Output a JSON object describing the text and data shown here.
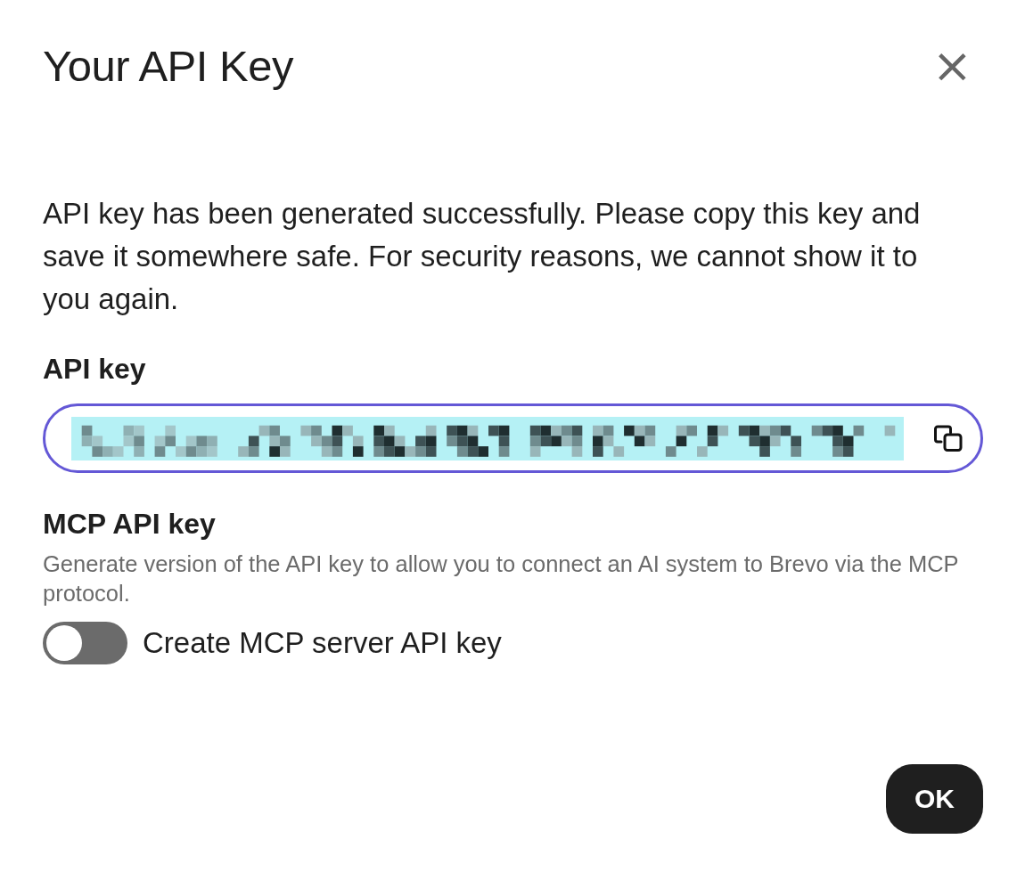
{
  "dialog": {
    "title": "Your API Key",
    "close_button": "×"
  },
  "message": "API key has been generated successfully. Please copy this key and save it somewhere safe. For security reasons, we cannot show it to you again.",
  "api_key": {
    "label": "API key",
    "value_redacted": true,
    "focused": true
  },
  "mcp": {
    "heading": "MCP API key",
    "description": "Generate version of the API key to allow you to connect an AI system to Brevo via the MCP protocol.",
    "toggle": {
      "label": "Create MCP server API key",
      "on": false
    }
  },
  "buttons": [
    {
      "label": "OK",
      "kind": "primary"
    }
  ]
}
